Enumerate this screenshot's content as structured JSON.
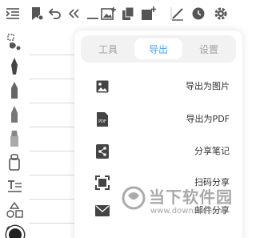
{
  "toolbar": {
    "icons": [
      "list-indent-icon",
      "bookmark-edit-icon",
      "undo-icon",
      "double-chevron-left-icon",
      "underline-icon",
      "image-add-icon",
      "copy-icon",
      "shape-add-icon",
      "pen-icon",
      "clock-icon",
      "gear-icon"
    ]
  },
  "left_tools": [
    "lasso-icon",
    "fountain-pen-icon",
    "pencil-icon",
    "marker-icon",
    "highlighter-icon",
    "eraser-icon",
    "text-tool-icon",
    "shapes-icon",
    "sticker-icon",
    "color-dot-icon"
  ],
  "popup": {
    "tabs": [
      {
        "label": "工具",
        "active": false
      },
      {
        "label": "导出",
        "active": true
      },
      {
        "label": "设置",
        "active": false
      }
    ],
    "items": [
      {
        "label": "导出为图片",
        "icon": "image-icon"
      },
      {
        "label": "导出为PDF",
        "icon": "pdf-icon",
        "icon_text": "PDF"
      },
      {
        "label": "分享笔记",
        "icon": "share-icon"
      },
      {
        "label": "扫码分享",
        "icon": "scan-icon"
      },
      {
        "label": "邮件分享",
        "icon": "mail-icon"
      }
    ]
  },
  "watermark": {
    "name": "当下软件园",
    "url": "www.downxia.com"
  },
  "colors": {
    "accent": "#4ea0f0",
    "icon": "#555555",
    "tab_bg": "#f2f2f2"
  }
}
